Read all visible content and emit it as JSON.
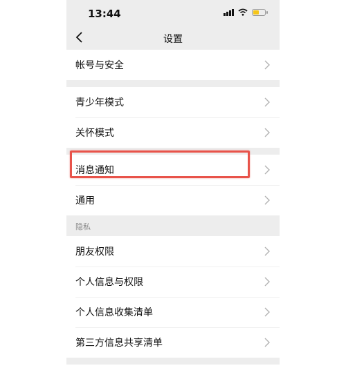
{
  "status_bar": {
    "time": "13:44",
    "battery_level": 0.55,
    "battery_color": "#f5c518"
  },
  "nav": {
    "title": "设置",
    "back_icon": "chevron-left-icon"
  },
  "groups": [
    {
      "rows": [
        {
          "label": "帐号与安全"
        }
      ]
    },
    {
      "rows": [
        {
          "label": "青少年模式"
        },
        {
          "label": "关怀模式"
        }
      ]
    },
    {
      "rows": [
        {
          "label": "消息通知"
        },
        {
          "label": "通用"
        }
      ]
    },
    {
      "section_label": "隐私",
      "rows": [
        {
          "label": "朋友权限"
        },
        {
          "label": "个人信息与权限"
        },
        {
          "label": "个人信息收集清单"
        },
        {
          "label": "第三方信息共享清单"
        }
      ]
    }
  ],
  "highlight": {
    "target": "消息通知",
    "color": "#e8534a"
  }
}
